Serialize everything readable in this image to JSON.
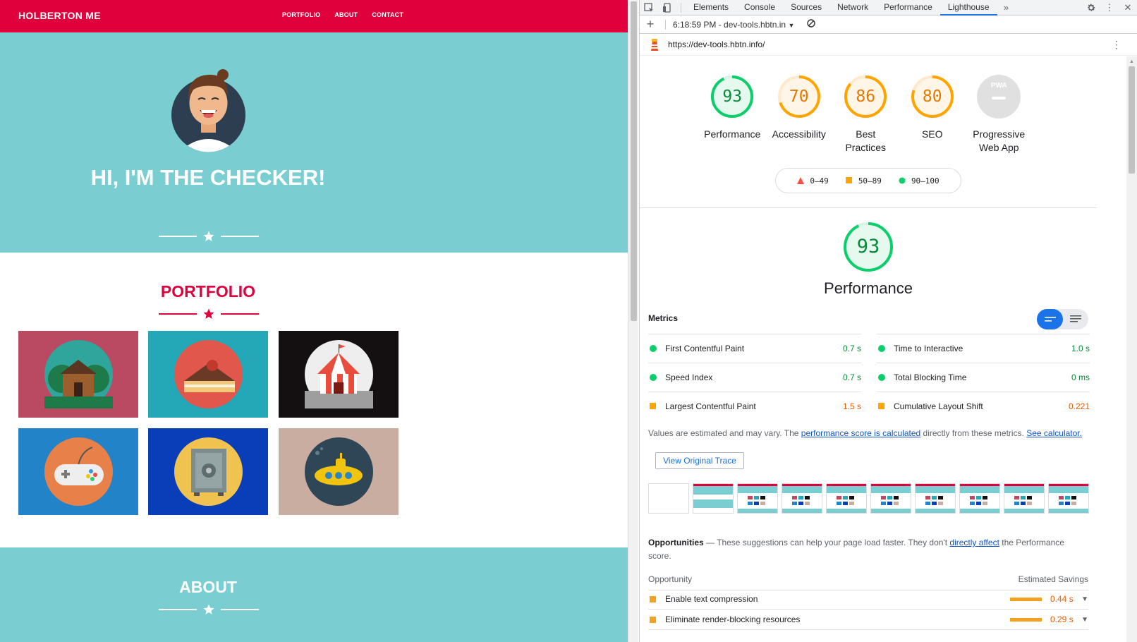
{
  "site": {
    "brand": "HOLBERTON ME",
    "nav": [
      "PORTFOLIO",
      "ABOUT",
      "CONTACT"
    ],
    "hero_title": "HI, I'M THE CHECKER!",
    "portfolio_title": "PORTFOLIO",
    "about_title": "ABOUT",
    "colors": {
      "red": "#e0003c",
      "teal": "#7acdd0"
    }
  },
  "devtools": {
    "tabs": [
      "Elements",
      "Console",
      "Sources",
      "Network",
      "Performance",
      "Lighthouse"
    ],
    "active_tab": "Lighthouse",
    "report_select": "6:18:59 PM - dev-tools.hbtn.in",
    "url": "https://dev-tools.hbtn.info/"
  },
  "lighthouse": {
    "categories": [
      {
        "label": "Performance",
        "score": 93,
        "status": "pass"
      },
      {
        "label": "Accessibility",
        "score": 70,
        "status": "average"
      },
      {
        "label": "Best Practices",
        "score": 86,
        "status": "average"
      },
      {
        "label": "SEO",
        "score": 80,
        "status": "average"
      },
      {
        "label": "Progressive Web App",
        "score": null,
        "status": "na"
      }
    ],
    "pwa_badge": "PWA",
    "legend": [
      "0–49",
      "50–89",
      "90–100"
    ],
    "performance_score": "93",
    "performance_title": "Performance",
    "metrics_heading": "Metrics",
    "metrics": [
      {
        "name": "First Contentful Paint",
        "value": "0.7 s",
        "status": "pass"
      },
      {
        "name": "Time to Interactive",
        "value": "1.0 s",
        "status": "pass"
      },
      {
        "name": "Speed Index",
        "value": "0.7 s",
        "status": "pass"
      },
      {
        "name": "Total Blocking Time",
        "value": "0 ms",
        "status": "pass"
      },
      {
        "name": "Largest Contentful Paint",
        "value": "1.5 s",
        "status": "average"
      },
      {
        "name": "Cumulative Layout Shift",
        "value": "0.221",
        "status": "average"
      }
    ],
    "note": {
      "prefix": "Values are estimated and may vary. The ",
      "link1": "performance score is calculated",
      "middle": " directly from these metrics. ",
      "link2": "See calculator."
    },
    "trace_button": "View Original Trace",
    "opportunities": {
      "title": "Opportunities",
      "dash": " — ",
      "text1": "These suggestions can help your page load faster. They don't ",
      "link": "directly affect",
      "text2": " the Performance score.",
      "col_left": "Opportunity",
      "col_right": "Estimated Savings",
      "rows": [
        {
          "name": "Enable text compression",
          "savings": "0.44 s"
        },
        {
          "name": "Eliminate render-blocking resources",
          "savings": "0.29 s"
        }
      ]
    },
    "colors": {
      "pass": "#0cce6b",
      "average": "#ffa400",
      "fail": "#ff4e42"
    }
  }
}
